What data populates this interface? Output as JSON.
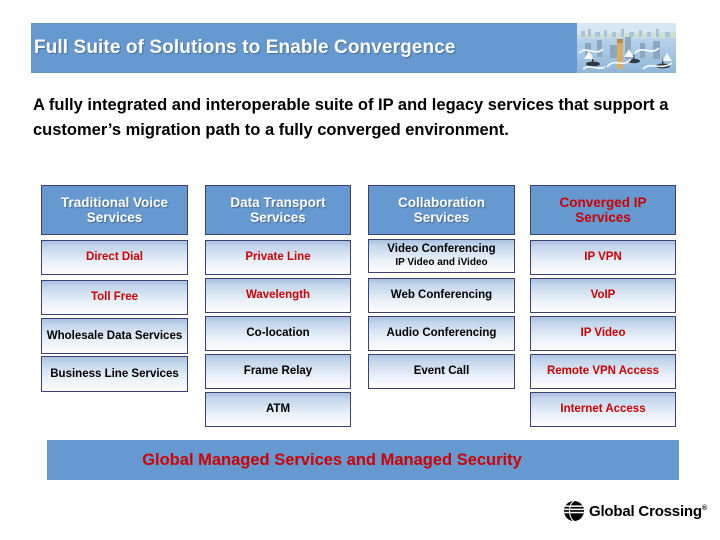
{
  "slide": {
    "title": "Full Suite of Solutions to Enable Convergence",
    "header_image_alt": "harbor-city-illustration",
    "body": "A fully integrated and interoperable suite of IP and legacy services that support a customer’s migration path to a fully converged environment.",
    "footer_banner": "Global Managed Services and Managed Security"
  },
  "colors": {
    "band_blue": "#6699cf",
    "header_cell_blue": "#6699cf",
    "cell_border": "#3f3f76",
    "accent_red": "#cc0000",
    "text_black": "#000000",
    "text_white": "#ffffff"
  },
  "matrix": {
    "columns": [
      {
        "header": "Traditional Voice Services",
        "header_color": "#ffffff",
        "items": [
          {
            "label": "Direct Dial",
            "color": "#cc0000"
          },
          {
            "label": "Toll Free",
            "color": "#cc0000"
          },
          {
            "label": "Wholesale Data Services",
            "color": "#000000"
          },
          {
            "label": "Business Line Services",
            "color": "#000000"
          }
        ]
      },
      {
        "header": "Data Transport Services",
        "header_color": "#ffffff",
        "items": [
          {
            "label": "Private Line",
            "color": "#cc0000"
          },
          {
            "label": "Wavelength",
            "color": "#cc0000"
          },
          {
            "label": "Co-location",
            "color": "#000000"
          },
          {
            "label": "Frame Relay",
            "color": "#000000"
          },
          {
            "label": "ATM",
            "color": "#000000"
          }
        ]
      },
      {
        "header": "Collaboration Services",
        "header_color": "#ffffff",
        "items": [
          {
            "label": "Video Conferencing",
            "sub": "IP Video and iVideo",
            "color": "#000000"
          },
          {
            "label": "Web Conferencing",
            "color": "#000000"
          },
          {
            "label": "Audio Conferencing",
            "color": "#000000"
          },
          {
            "label": "Event Call",
            "color": "#000000"
          }
        ]
      },
      {
        "header": "Converged IP Services",
        "header_color": "#cc0000",
        "items": [
          {
            "label": "IP VPN",
            "color": "#cc0000"
          },
          {
            "label": "VoIP",
            "color": "#cc0000"
          },
          {
            "label": "IP Video",
            "color": "#cc0000"
          },
          {
            "label": "Remote VPN Access",
            "color": "#cc0000"
          },
          {
            "label": "Internet Access",
            "color": "#cc0000"
          }
        ]
      }
    ]
  },
  "logo": {
    "mark": "globe-stripes-icon",
    "name": "Global Crossing",
    "registered": "®"
  }
}
